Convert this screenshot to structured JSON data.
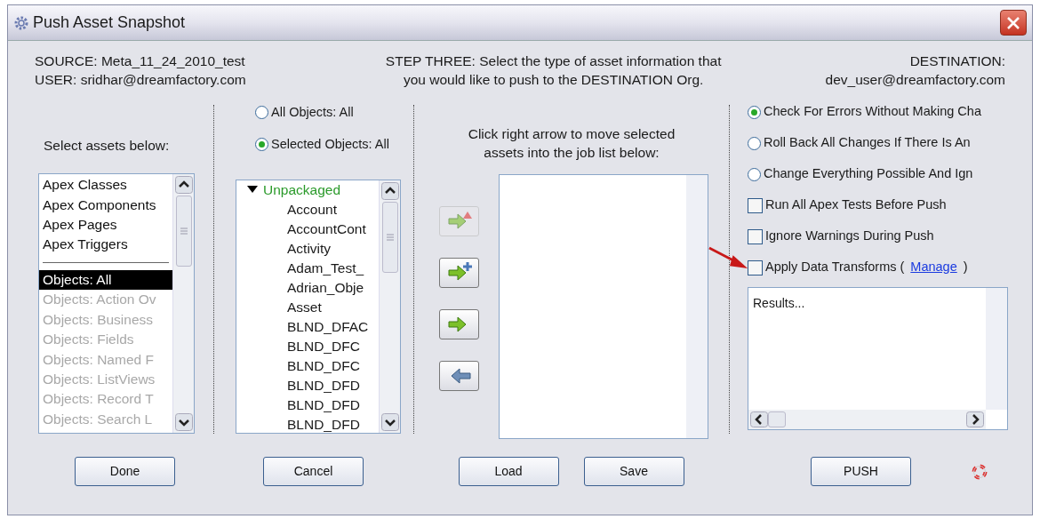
{
  "window": {
    "title": "Push Asset Snapshot"
  },
  "header": {
    "source": "SOURCE: Meta_11_24_2010_test",
    "user": "USER: sridhar@dreamfactory.com",
    "step": [
      "STEP THREE: Select the type of asset information that",
      "you would like to push to the DESTINATION Org."
    ],
    "destination_label": "DESTINATION:",
    "destination": "dev_user@dreamfactory.com"
  },
  "assets": {
    "label": "Select assets below:",
    "items": [
      {
        "kind": "item",
        "label": "Apex Classes",
        "selected": false,
        "disabled": false
      },
      {
        "kind": "item",
        "label": "Apex Components",
        "selected": false,
        "disabled": false
      },
      {
        "kind": "item",
        "label": "Apex Pages",
        "selected": false,
        "disabled": false
      },
      {
        "kind": "item",
        "label": "Apex Triggers",
        "selected": false,
        "disabled": false
      },
      {
        "kind": "separator"
      },
      {
        "kind": "item",
        "label": "Objects: All",
        "selected": true,
        "disabled": false
      },
      {
        "kind": "item",
        "label": "Objects: Action Ov",
        "selected": false,
        "disabled": true
      },
      {
        "kind": "item",
        "label": "Objects: Business",
        "selected": false,
        "disabled": true
      },
      {
        "kind": "item",
        "label": "Objects: Fields",
        "selected": false,
        "disabled": true
      },
      {
        "kind": "item",
        "label": "Objects: Named F",
        "selected": false,
        "disabled": true
      },
      {
        "kind": "item",
        "label": "Objects: ListViews",
        "selected": false,
        "disabled": true
      },
      {
        "kind": "item",
        "label": "Objects: Record T",
        "selected": false,
        "disabled": true
      },
      {
        "kind": "item",
        "label": "Objects: Search L",
        "selected": false,
        "disabled": true
      }
    ]
  },
  "scope": [
    {
      "label": "All Objects: All",
      "selected": false
    },
    {
      "label": "Selected Objects: All",
      "selected": true
    }
  ],
  "tree": [
    {
      "label": "Unpackaged",
      "expanded": true,
      "children": [
        {
          "label": "Account"
        },
        {
          "label": "AccountCont"
        },
        {
          "label": "Activity"
        },
        {
          "label": "Adam_Test_"
        },
        {
          "label": "Adrian_Obje"
        },
        {
          "label": "Asset"
        },
        {
          "label": "BLND_DFAC"
        },
        {
          "label": "BLND_DFC"
        },
        {
          "label": "BLND_DFC"
        },
        {
          "label": "BLND_DFD"
        },
        {
          "label": "BLND_DFD"
        },
        {
          "label": "BLND_DFD"
        }
      ]
    }
  ],
  "job": {
    "instruction": [
      "Click right arrow to move selected",
      "assets into the job list below:"
    ],
    "arrow_buttons": [
      {
        "kind": "warn",
        "disabled": true
      },
      {
        "kind": "add",
        "disabled": false
      },
      {
        "kind": "move",
        "disabled": false
      },
      {
        "kind": "remove",
        "disabled": false
      }
    ]
  },
  "options": [
    {
      "kind": "radio",
      "label": "Check For Errors Without Making Cha",
      "selected": true
    },
    {
      "kind": "radio",
      "label": "Roll Back All Changes If There Is An",
      "selected": false
    },
    {
      "kind": "radio",
      "label": "Change Everything Possible And Ign",
      "selected": false
    },
    {
      "kind": "checkbox",
      "label": "Run All Apex Tests Before Push",
      "checked": false
    },
    {
      "kind": "checkbox",
      "label": "Ignore Warnings During Push",
      "checked": false
    },
    {
      "kind": "checkbox",
      "label": "Apply Data Transforms (",
      "checked": false,
      "link": "Manage",
      "suffix": ")"
    }
  ],
  "results": {
    "text": "Results..."
  },
  "buttons": {
    "done": "Done",
    "cancel": "Cancel",
    "load": "Load",
    "save": "Save",
    "push": "PUSH"
  }
}
